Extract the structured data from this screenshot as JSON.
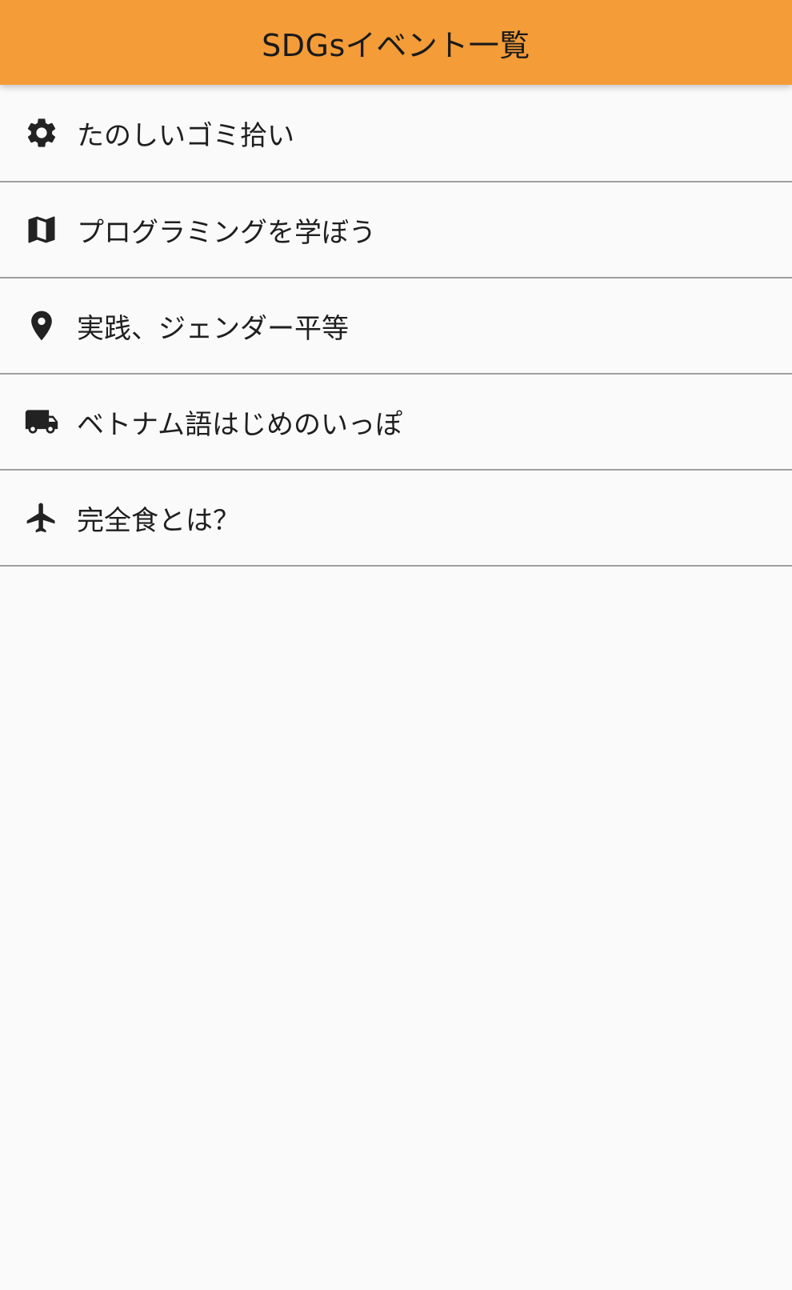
{
  "app_bar": {
    "title": "SDGsイベント一覧",
    "background": "#f39c38"
  },
  "events": [
    {
      "label": "たのしいゴミ拾い",
      "icon": "gear-icon"
    },
    {
      "label": "プログラミングを学ぼう",
      "icon": "map-icon"
    },
    {
      "label": "実践、ジェンダー平等",
      "icon": "location-pin-icon"
    },
    {
      "label": "ベトナム語はじめのいっぽ",
      "icon": "truck-icon"
    },
    {
      "label": "完全食とは？",
      "icon": "airplane-icon"
    }
  ]
}
